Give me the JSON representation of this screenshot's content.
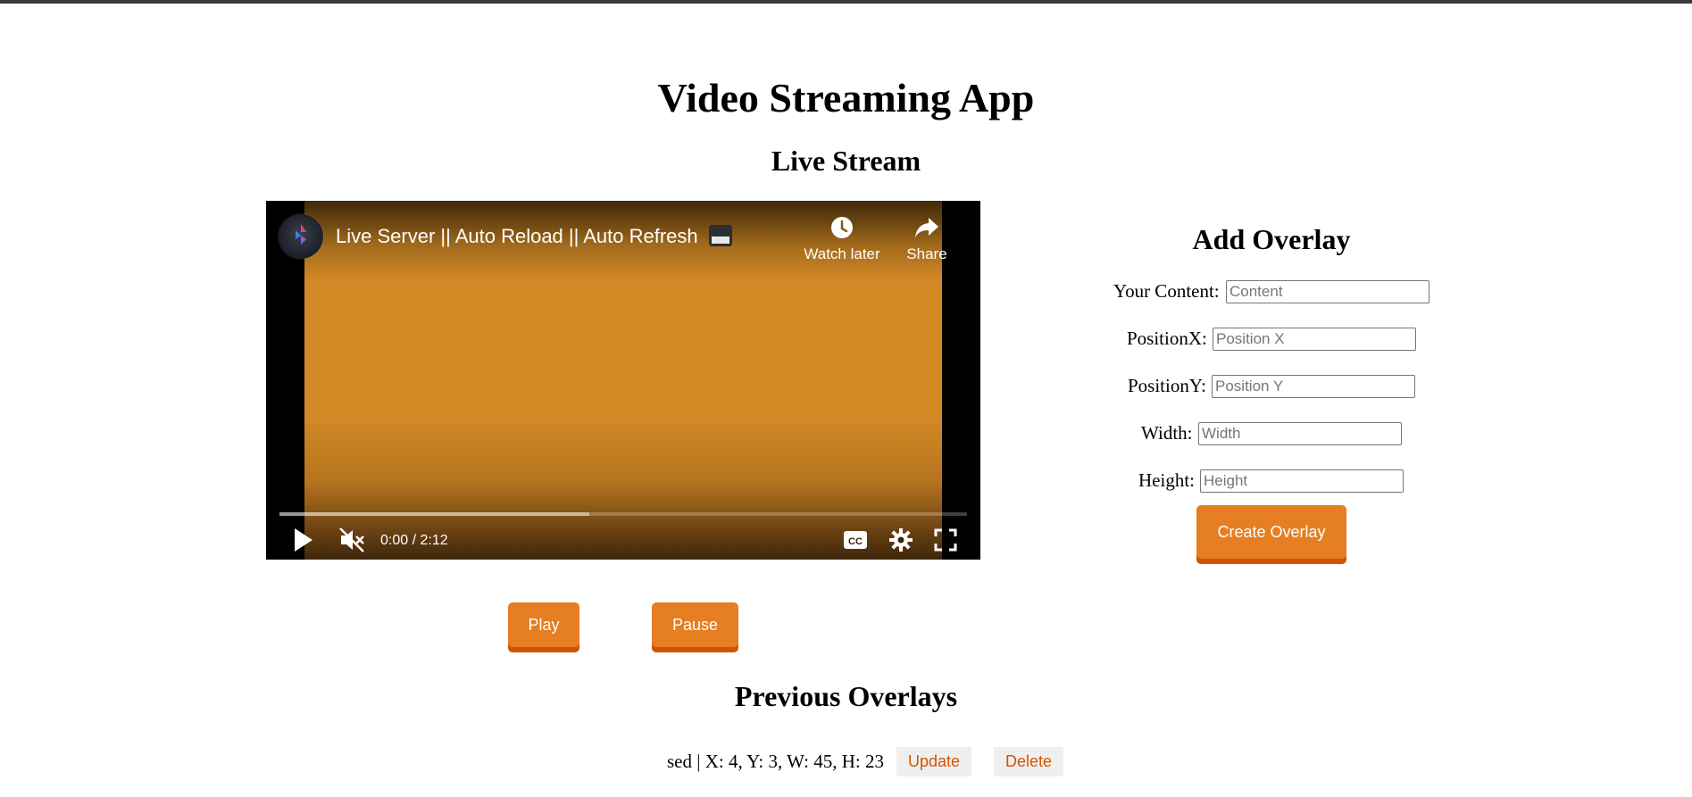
{
  "app": {
    "title": "Video Streaming App"
  },
  "stream": {
    "title": "Live Stream",
    "player": {
      "video_title": "Live Server || Auto Reload || Auto Refresh",
      "watch_later_label": "Watch later",
      "share_label": "Share",
      "time": "0:00 / 2:12",
      "muted": true,
      "buffered_fraction": 0.45,
      "background_color": "#d38a26"
    },
    "controls": {
      "play_label": "Play",
      "pause_label": "Pause"
    }
  },
  "overlay_form": {
    "title": "Add Overlay",
    "content_label": "Your Content:",
    "content_placeholder": "Content",
    "posx_label": "PositionX:",
    "posx_placeholder": "Position X",
    "posy_label": "PositionY:",
    "posy_placeholder": "Position Y",
    "width_label": "Width:",
    "width_placeholder": "Width",
    "height_label": "Height:",
    "height_placeholder": "Height",
    "submit_label": "Create Overlay"
  },
  "previous_overlays": {
    "title": "Previous Overlays",
    "items": [
      {
        "text": "sed | X: 4, Y: 3, W: 45, H: 23",
        "update_label": "Update",
        "delete_label": "Delete"
      }
    ]
  },
  "colors": {
    "accent": "#e67e22",
    "accent_shadow": "#d35400",
    "secondary_button_bg": "#efefef"
  },
  "icons": [
    "channel-avatar",
    "clock-icon",
    "share-arrow-icon",
    "play-icon",
    "volume-muted-icon",
    "closed-captions-icon",
    "gear-icon",
    "fullscreen-icon"
  ]
}
